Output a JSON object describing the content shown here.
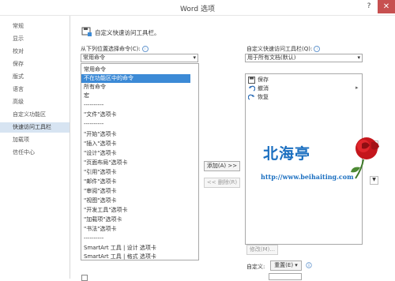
{
  "window": {
    "title": "Word 选项",
    "help": "?",
    "close": "✕"
  },
  "sidebar": {
    "items": [
      {
        "label": "常规"
      },
      {
        "label": "显示"
      },
      {
        "label": "校对"
      },
      {
        "label": "保存"
      },
      {
        "label": "版式"
      },
      {
        "label": "语言"
      },
      {
        "label": "高级"
      },
      {
        "label": "自定义功能区"
      },
      {
        "label": "快速访问工具栏",
        "active": true
      },
      {
        "label": "加载项"
      },
      {
        "label": "信任中心"
      }
    ]
  },
  "header": {
    "text": "自定义快速访问工具栏。"
  },
  "left": {
    "choose_label": "从下列位置选择命令(C):",
    "choose_value": "常用命令",
    "items": [
      "常用命令",
      "不在功能区中的命令",
      "所有命令",
      "宏",
      "----------",
      "\"文件\"选项卡",
      "----------",
      "\"开始\"选项卡",
      "\"插入\"选项卡",
      "\"设计\"选项卡",
      "\"页面布局\"选项卡",
      "\"引用\"选项卡",
      "\"邮件\"选项卡",
      "\"审阅\"选项卡",
      "\"视图\"选项卡",
      "\"开发工具\"选项卡",
      "\"加载项\"选项卡",
      "\"书法\"选项卡",
      "----------",
      "SmartArt 工具 | 设计 选项卡",
      "SmartArt 工具 | 格式 选项卡"
    ],
    "selected_index": 1
  },
  "buttons": {
    "add": "添加(A) >>",
    "remove": "<< 删除(R)"
  },
  "right": {
    "customize_label": "自定义快速访问工具栏(Q):",
    "customize_value": "用于所有文档(默认)",
    "items": [
      {
        "label": "保存",
        "icon": "save-icon"
      },
      {
        "label": "撤消",
        "icon": "undo-icon"
      },
      {
        "label": "恢复",
        "icon": "redo-icon"
      }
    ],
    "modify_label": "修改(M)...",
    "custom_label": "自定义:",
    "reset_label": "重置(E) ▾"
  },
  "watermark": {
    "text": "北海亭",
    "url": "http://www.beihaiting.com"
  },
  "colors": {
    "accent": "#3c8ad6",
    "nav_active": "#d7e4f2",
    "close": "#c75050",
    "watermark": "#1b6fc0"
  }
}
